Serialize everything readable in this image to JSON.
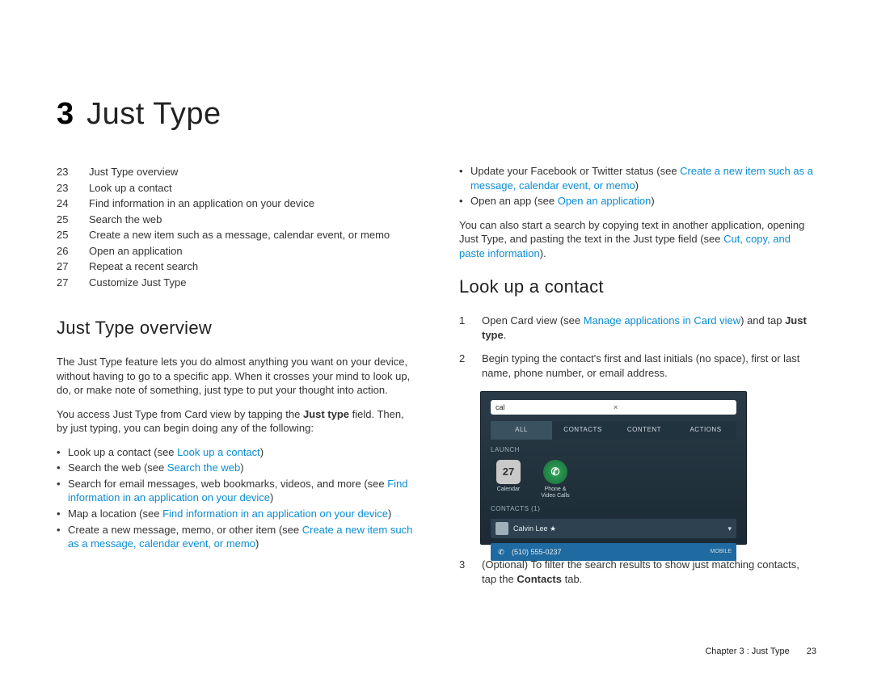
{
  "chapter": {
    "number": "3",
    "title": "Just Type"
  },
  "toc": [
    {
      "page": "23",
      "title": "Just Type overview"
    },
    {
      "page": "23",
      "title": "Look up a contact"
    },
    {
      "page": "24",
      "title": "Find information in an application on your device"
    },
    {
      "page": "25",
      "title": "Search the web"
    },
    {
      "page": "25",
      "title": "Create a new item such as a message, calendar event, or memo"
    },
    {
      "page": "26",
      "title": "Open an application"
    },
    {
      "page": "27",
      "title": "Repeat a recent search"
    },
    {
      "page": "27",
      "title": "Customize Just Type"
    }
  ],
  "left": {
    "h_overview": "Just Type overview",
    "p1a": "The Just Type feature lets you do almost anything you want on your device, without having to go to a specific app. When it crosses your mind to look up, do, or make note of something, just type to put your thought into action.",
    "p2a": "You access Just Type from Card view by tapping the ",
    "p2b": "Just type",
    "p2c": " field. Then, by just typing, you can begin doing any of the following:",
    "b1a": "Look up a contact (see ",
    "b1l": "Look up a contact",
    "b1z": ")",
    "b2a": "Search the web (see ",
    "b2l": "Search the web",
    "b2z": ")",
    "b3a": "Search for email messages, web bookmarks, videos, and more (see ",
    "b3l": "Find information in an application on your device",
    "b3z": ")",
    "b4a": "Map a location (see ",
    "b4l": "Find information in an application on your device",
    "b4z": ")",
    "b5a": "Create a new message, memo, or other item (see ",
    "b5l": "Create a new item such as a message, calendar event, or memo",
    "b5z": ")"
  },
  "right": {
    "b6a": "Update your Facebook or Twitter status (see ",
    "b6l": "Create a new item such as a message, calendar event, or memo",
    "b6z": ")",
    "b7a": "Open an app (see ",
    "b7l": "Open an application",
    "b7z": ")",
    "p3a": "You can also start a search by copying text in another application, opening Just Type, and pasting the text in the Just type field (see ",
    "p3l": "Cut, copy, and paste information",
    "p3z": ").",
    "h_lookup": "Look up a contact",
    "s1n": "1",
    "s1a": "Open Card view (see ",
    "s1l": "Manage applications in Card view",
    "s1b": ") and tap ",
    "s1c": "Just type",
    "s1d": ".",
    "s2n": "2",
    "s2a": "Begin typing the contact's first and last initials (no space), first or last name, phone number, or email address.",
    "s3n": "3",
    "s3a": "(Optional) To filter the search results to show just matching contacts, tap the ",
    "s3b": "Contacts",
    "s3c": " tab."
  },
  "shot": {
    "search": "cal",
    "tab_all": "ALL",
    "tab_contacts": "CONTACTS",
    "tab_content": "CONTENT",
    "tab_actions": "ACTIONS",
    "sec_launch": "LAUNCH",
    "icon_cal": "Calendar",
    "icon_cal_day": "27",
    "icon_phone": "Phone & Video Calls",
    "sec_contacts": "CONTACTS (1)",
    "row_name": "Calvin Lee ★",
    "row_phone": "(510) 555-0237",
    "row_tag": "MOBILE"
  },
  "footer": {
    "label": "Chapter 3 : Just Type",
    "page": "23"
  }
}
